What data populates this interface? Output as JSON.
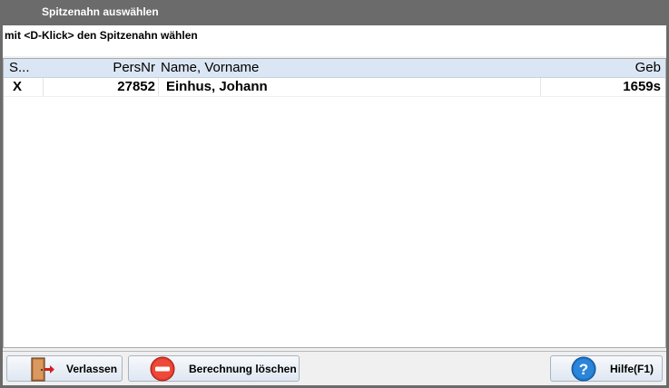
{
  "window": {
    "title": "Spitzenahn auswählen"
  },
  "hint": "mit <D-Klick> den Spitzenahn wählen",
  "table": {
    "columns": [
      "S...",
      "PersNr",
      "Name, Vorname",
      "Geb"
    ],
    "rows": [
      {
        "s": "X",
        "persnr": "27852",
        "name": "Einhus, Johann",
        "geb": "1659s"
      }
    ]
  },
  "buttons": {
    "exit": "Verlassen",
    "delete": "Berechnung löschen",
    "help": "Hilfe(F1)"
  },
  "icons": {
    "exit": "door-exit-icon",
    "delete": "no-entry-icon",
    "help": "question-mark-icon"
  }
}
